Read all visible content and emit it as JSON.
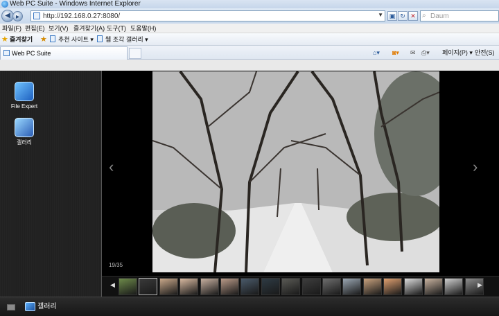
{
  "window": {
    "title": "Web PC Suite - Windows Internet Explorer"
  },
  "address": {
    "url": "http://192.168.0.27:8080/",
    "search_placeholder": "Daum"
  },
  "menu": [
    "파일(F)",
    "편집(E)",
    "보기(V)",
    "즐겨찾기(A)",
    "도구(T)",
    "도움말(H)"
  ],
  "favorites": {
    "label": "즐겨찾기",
    "items": [
      "추천 사이트 ▾",
      "웹 조각 갤러리 ▾"
    ]
  },
  "tab": {
    "label": "Web PC Suite"
  },
  "commandbar": {
    "page": "페이지(P) ▾",
    "safety": "안전(S) ▾"
  },
  "desktop": {
    "icons": [
      {
        "label": "File Expert",
        "icon": "file-expert-icon"
      },
      {
        "label": "갤러리",
        "icon": "gallery-icon"
      }
    ]
  },
  "viewer": {
    "counter": "19/35",
    "thumbnail_count": 18,
    "current_thumbnail": 1
  },
  "taskbar": {
    "item_label": "갤러리"
  },
  "colors": {
    "chrome": "#dde8f5",
    "viewer_bg": "#000000",
    "desktop_bg": "#222222",
    "accent": "#3a78c2"
  }
}
